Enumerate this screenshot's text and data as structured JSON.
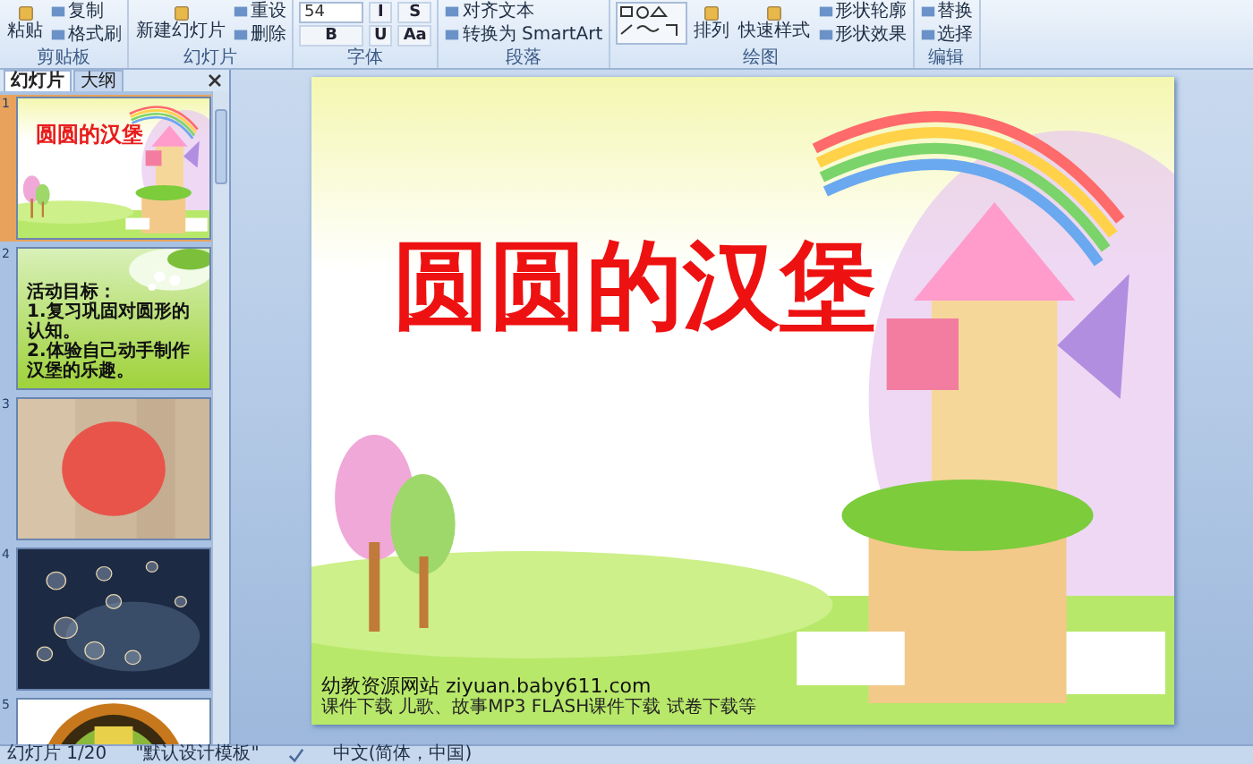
{
  "ribbon": {
    "groups": [
      {
        "label": "剪贴板",
        "items": [
          {
            "kind": "large",
            "label": "粘贴"
          },
          {
            "kind": "small",
            "label": "复制"
          },
          {
            "kind": "small",
            "label": "格式刷"
          }
        ]
      },
      {
        "label": "幻灯片",
        "items": [
          {
            "kind": "large",
            "label": "新建幻灯片"
          },
          {
            "kind": "small",
            "label": "重设"
          },
          {
            "kind": "small",
            "label": "删除"
          }
        ]
      },
      {
        "label": "字体",
        "items": [
          {
            "kind": "field",
            "value": "54"
          },
          {
            "kind": "tool",
            "label": "B"
          },
          {
            "kind": "tool",
            "label": "I"
          },
          {
            "kind": "tool",
            "label": "U"
          },
          {
            "kind": "tool",
            "label": "S"
          },
          {
            "kind": "tool",
            "label": "Aa"
          }
        ]
      },
      {
        "label": "段落",
        "items": [
          {
            "kind": "small",
            "label": "对齐文本"
          },
          {
            "kind": "small",
            "label": "转换为 SmartArt"
          }
        ]
      },
      {
        "label": "绘图",
        "items": [
          {
            "kind": "shapes"
          },
          {
            "kind": "large",
            "label": "排列"
          },
          {
            "kind": "large",
            "label": "快速样式"
          },
          {
            "kind": "small",
            "label": "形状轮廓"
          },
          {
            "kind": "small",
            "label": "形状效果"
          }
        ]
      },
      {
        "label": "编辑",
        "items": [
          {
            "kind": "small",
            "label": "替换"
          },
          {
            "kind": "small",
            "label": "选择"
          }
        ]
      }
    ]
  },
  "slide_panel": {
    "tabs": [
      {
        "label": "幻灯片",
        "selected": true
      },
      {
        "label": "大纲",
        "selected": false
      }
    ],
    "slides": [
      {
        "number": "1",
        "selected": true,
        "kind": "title",
        "title": "圆圆的汉堡"
      },
      {
        "number": "2",
        "selected": false,
        "kind": "text",
        "heading": "活动目标：",
        "lines": [
          "1.复习巩固对圆形的认知。",
          "2.体验自己动手制作汉堡的乐趣。"
        ]
      },
      {
        "number": "3",
        "selected": false,
        "kind": "picture"
      },
      {
        "number": "4",
        "selected": false,
        "kind": "picture"
      },
      {
        "number": "5",
        "selected": false,
        "kind": "picture"
      }
    ]
  },
  "slide": {
    "title": "圆圆的汉堡",
    "footer": "幼教资源网站 ziyuan.baby611.com",
    "footer_note": "课件下载 儿歌、故事MP3 FLASH课件下载 试卷下载等"
  },
  "status_bar": {
    "slide_number": "幻灯片 1/20",
    "theme": "\"默认设计模板\"",
    "language": "中文(简体，中国)"
  }
}
